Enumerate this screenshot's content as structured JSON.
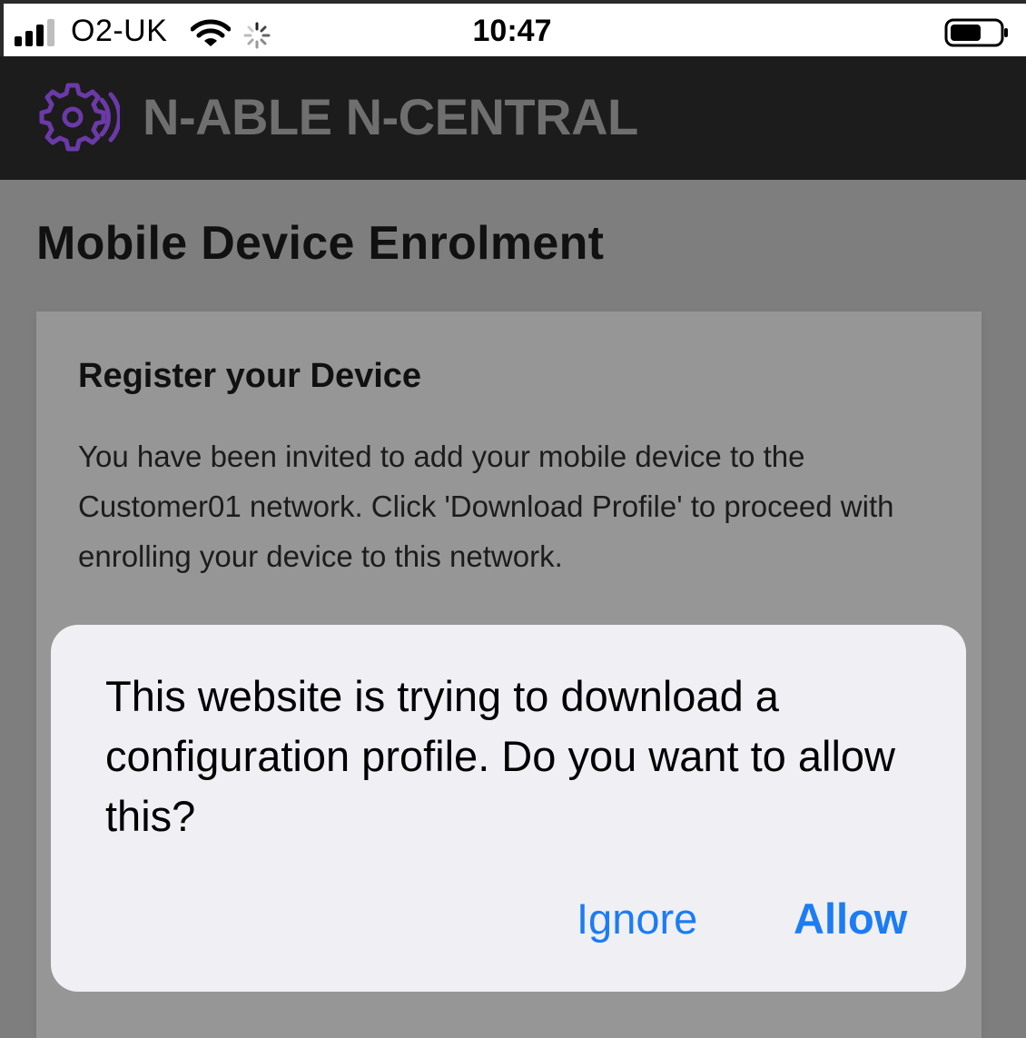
{
  "status_bar": {
    "carrier": "O2-UK",
    "time": "10:47",
    "icons": [
      "signal-icon",
      "wifi-icon",
      "activity-spinner-icon",
      "battery-icon"
    ]
  },
  "header": {
    "brand": "N-ABLE N-CENTRAL",
    "logo_icon": "gear-icon",
    "logo_color": "#6b3aa8"
  },
  "page": {
    "title": "Mobile Device Enrolment",
    "card": {
      "title": "Register your Device",
      "body": "You have been invited to add your mobile device to the Customer01 network. Click 'Download Profile' to proceed with enrolling your device to this network."
    }
  },
  "dialog": {
    "message": "This website is trying to download a configuration profile. Do you want to allow this?",
    "buttons": {
      "ignore": "Ignore",
      "allow": "Allow"
    },
    "button_color": "#1b7cf4"
  }
}
